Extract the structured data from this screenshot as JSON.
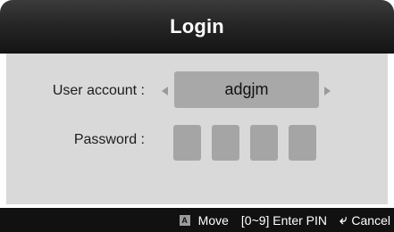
{
  "dialog": {
    "title": "Login"
  },
  "form": {
    "account_label": "User account :",
    "account_value": "adgjm",
    "password_label": "Password :",
    "pin_boxes": 4
  },
  "status_bar": {
    "move_key": "A",
    "move_label": "Move",
    "pin_label": "[0~9] Enter PIN",
    "return_icon": "return-icon",
    "cancel_label": "Cancel"
  },
  "colors": {
    "title_bar": "#1e1e1e",
    "content_bg": "#d9d9d9",
    "field_bg": "#a8a8a8",
    "status_bar": "#111111"
  }
}
